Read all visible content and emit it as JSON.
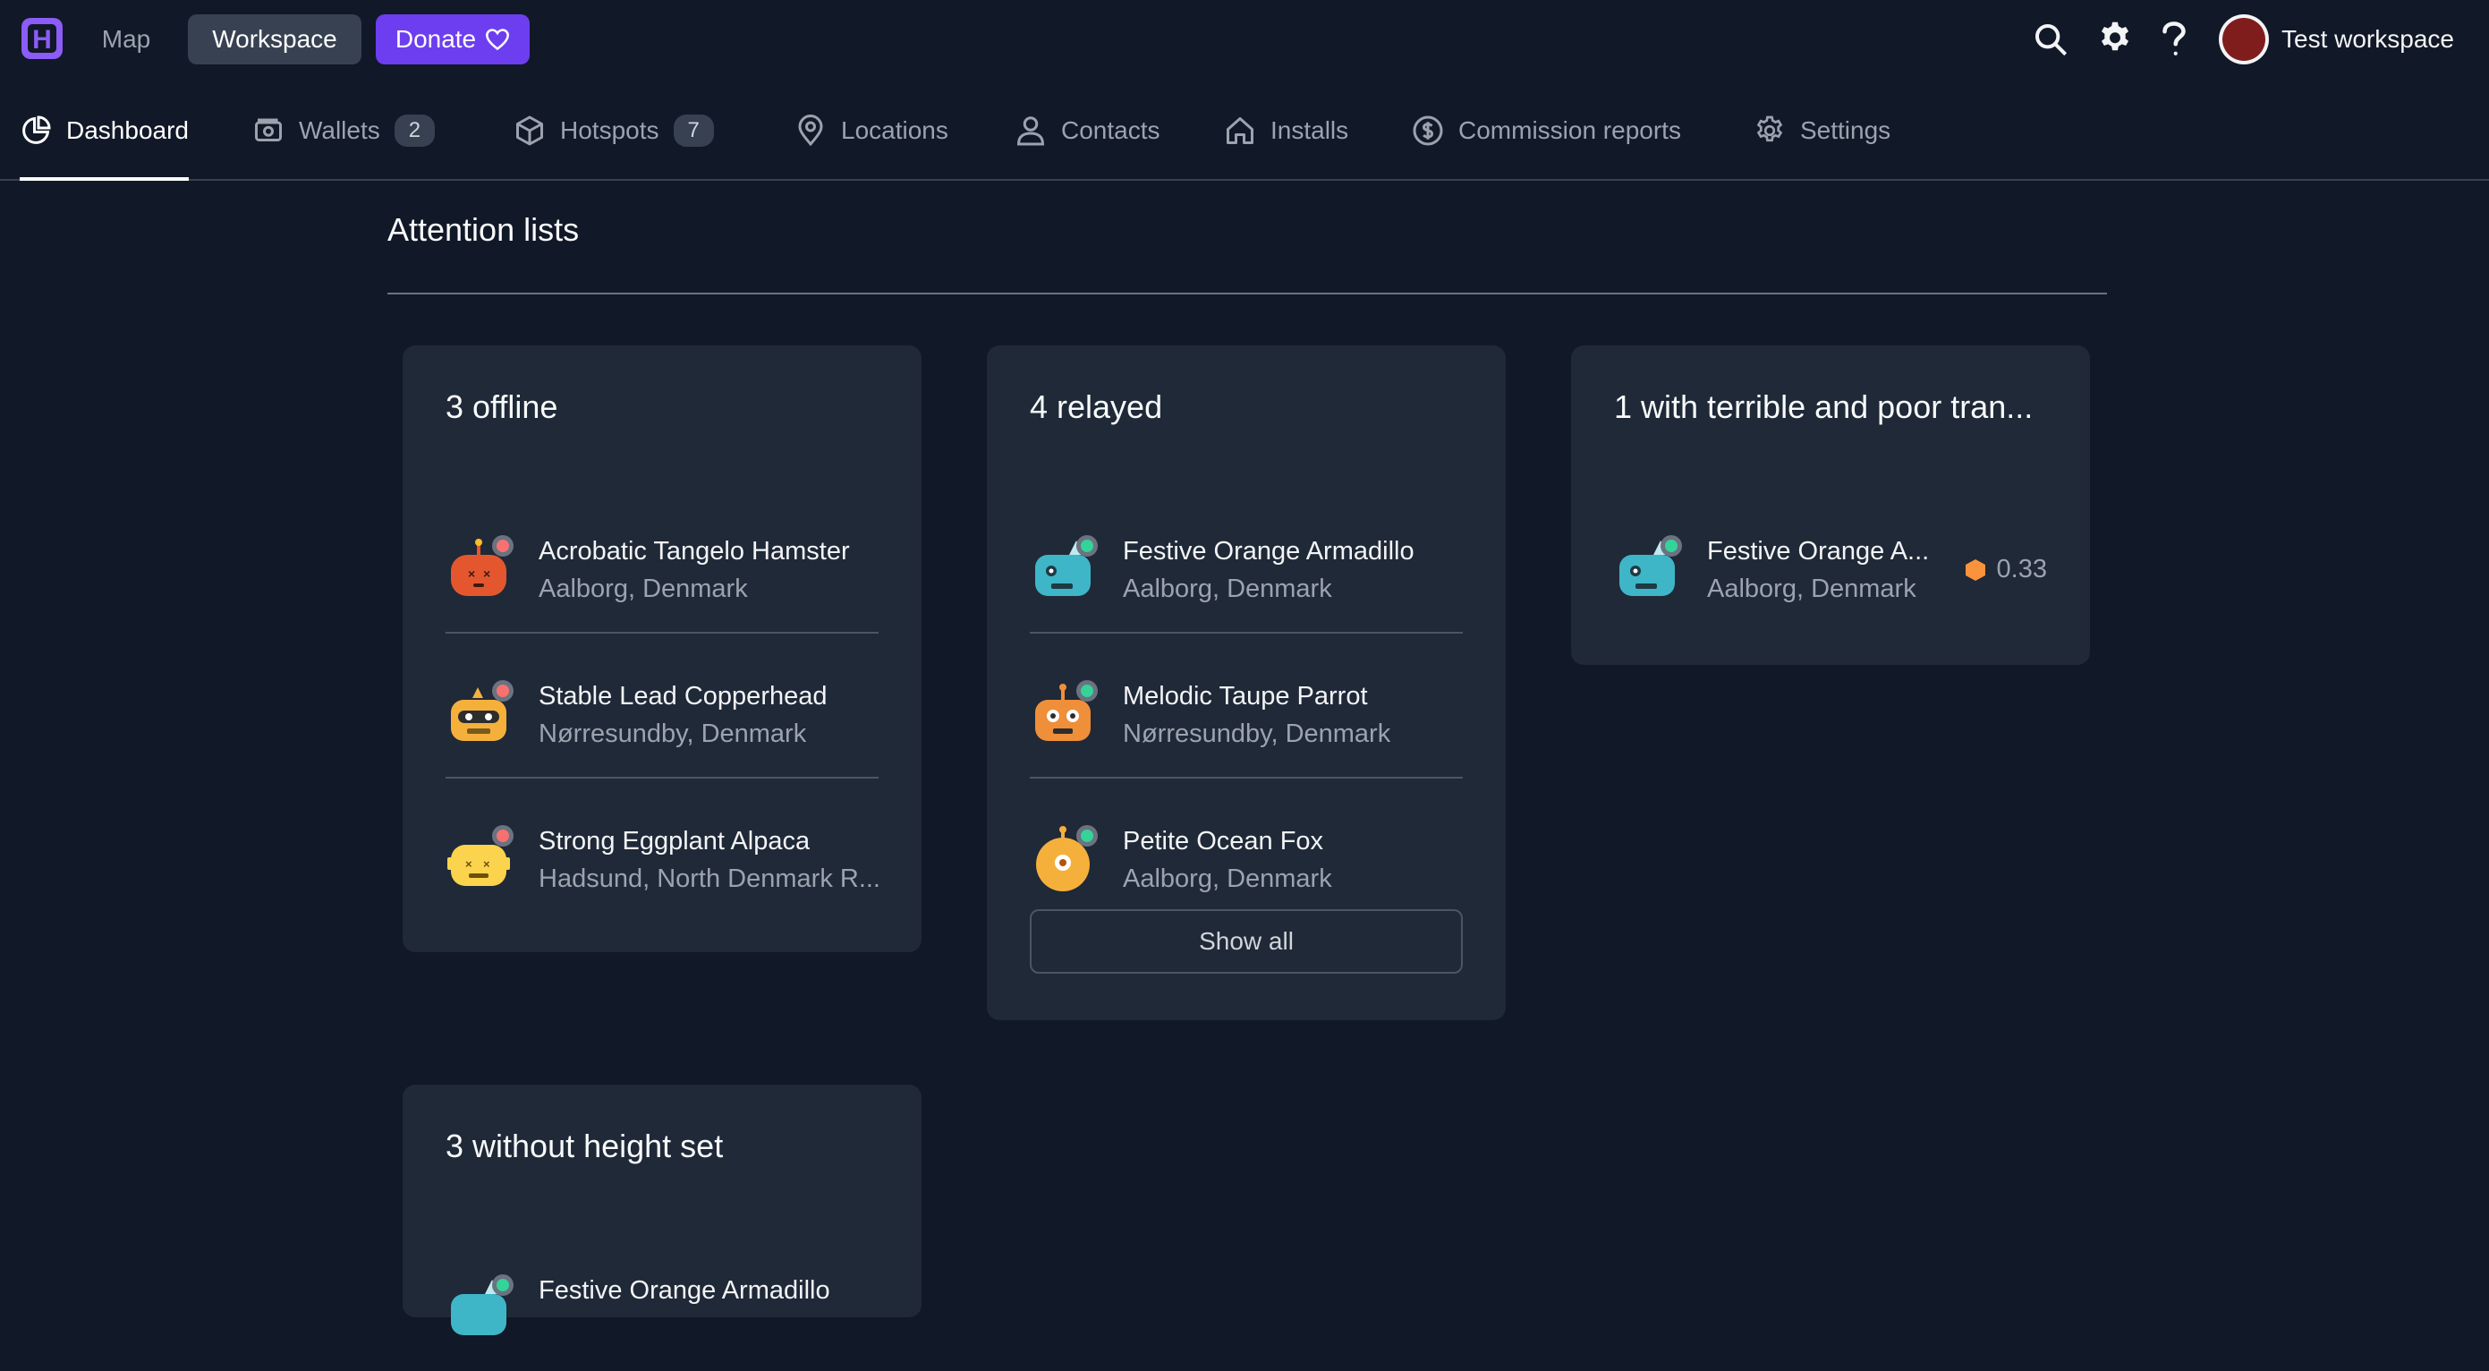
{
  "topbar": {
    "logo_letter": "H",
    "nav_map": "Map",
    "nav_workspace": "Workspace",
    "nav_donate": "Donate",
    "account_name": "Test workspace"
  },
  "tabs": [
    {
      "label": "Dashboard",
      "icon": "pie-chart-icon",
      "active": true
    },
    {
      "label": "Wallets",
      "icon": "wallet-icon",
      "badge": "2"
    },
    {
      "label": "Hotspots",
      "icon": "cube-icon",
      "badge": "7"
    },
    {
      "label": "Locations",
      "icon": "map-pin-icon"
    },
    {
      "label": "Contacts",
      "icon": "user-icon"
    },
    {
      "label": "Installs",
      "icon": "home-icon"
    },
    {
      "label": "Commission reports",
      "icon": "dollar-circle-icon"
    },
    {
      "label": "Settings",
      "icon": "gear-icon"
    }
  ],
  "section": {
    "title": "Attention lists"
  },
  "cards": {
    "offline": {
      "title": "3 offline",
      "items": [
        {
          "name": "Acrobatic Tangelo Hamster",
          "location": "Aalborg, Denmark",
          "status": "offline"
        },
        {
          "name": "Stable Lead Copperhead",
          "location": "Nørresundby, Denmark",
          "status": "offline"
        },
        {
          "name": "Strong Eggplant Alpaca",
          "location": "Hadsund, North Denmark R...",
          "status": "offline"
        }
      ]
    },
    "relayed": {
      "title": "4 relayed",
      "items": [
        {
          "name": "Festive Orange Armadillo",
          "location": "Aalborg, Denmark",
          "status": "online"
        },
        {
          "name": "Melodic Taupe Parrot",
          "location": "Nørresundby, Denmark",
          "status": "online"
        },
        {
          "name": "Petite Ocean Fox",
          "location": "Aalborg, Denmark",
          "status": "online"
        }
      ],
      "show_all": "Show all"
    },
    "transmit": {
      "title": "1 with terrible and poor tran...",
      "items": [
        {
          "name": "Festive Orange A...",
          "location": "Aalborg, Denmark",
          "score": "0.33",
          "status": "online"
        }
      ]
    },
    "height": {
      "title": "3 without height set",
      "items": [
        {
          "name": "Festive Orange Armadillo",
          "status": "online"
        }
      ]
    }
  },
  "colors": {
    "background": "#111827",
    "card": "#1f2937",
    "accent": "#6d3ef0",
    "online": "#34d399",
    "offline": "#f87171",
    "score": "#fb923c"
  }
}
